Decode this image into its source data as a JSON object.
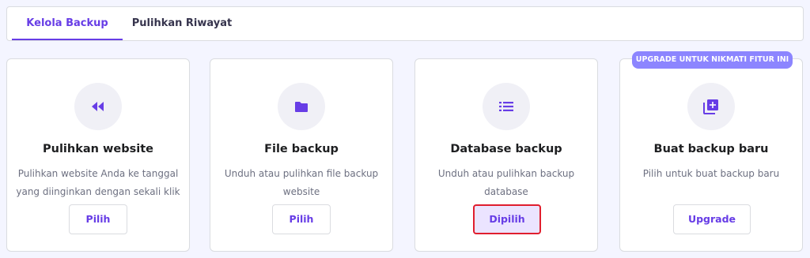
{
  "tabs": {
    "manage": "Kelola Backup",
    "history": "Pulihkan Riwayat"
  },
  "badge": "UPGRADE UNTUK NIKMATI FITUR INI",
  "cards": [
    {
      "icon": "rewind-icon",
      "title": "Pulihkan website",
      "desc_line1": "Pulihkan website Anda ke tanggal",
      "desc_line2": "yang diinginkan dengan sekali klik",
      "button": "Pilih"
    },
    {
      "icon": "folder-icon",
      "title": "File backup",
      "desc_line1": "Unduh atau pulihkan file backup",
      "desc_line2": "website",
      "button": "Pilih"
    },
    {
      "icon": "list-icon",
      "title": "Database backup",
      "desc_line1": "Unduh atau pulihkan backup",
      "desc_line2": "database",
      "button": "Dipilih"
    },
    {
      "icon": "add-copy-icon",
      "title": "Buat backup baru",
      "desc_line1": "Pilih untuk buat backup baru",
      "desc_line2": "",
      "button": "Upgrade"
    }
  ],
  "colors": {
    "accent": "#673de6",
    "badge": "#8c85ff",
    "selected_bg": "#ebe4ff",
    "selected_border": "#e01e2e"
  }
}
